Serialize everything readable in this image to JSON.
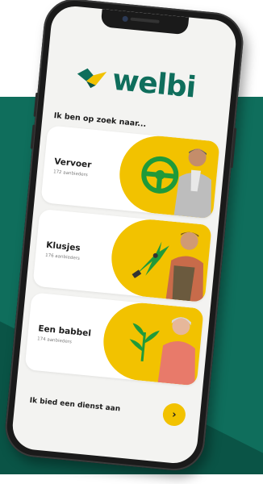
{
  "brand": {
    "name": "welbi",
    "primary_color": "#0f6e5c",
    "accent_color": "#f2c200",
    "logo_icon": "heart-logo-icon"
  },
  "screen": {
    "heading": "Ik ben op zoek naar..."
  },
  "services": [
    {
      "title": "Vervoer",
      "subtitle": "172 aanbieders",
      "tool_icon": "steering-wheel-icon"
    },
    {
      "title": "Klusjes",
      "subtitle": "176 aanbieders",
      "tool_icon": "hedge-shears-icon"
    },
    {
      "title": "Een babbel",
      "subtitle": "174 aanbieders",
      "tool_icon": "plant-icon"
    }
  ],
  "cta": {
    "label": "Ik bied een dienst aan",
    "icon": "chevron-right-icon",
    "glyph": "›"
  }
}
